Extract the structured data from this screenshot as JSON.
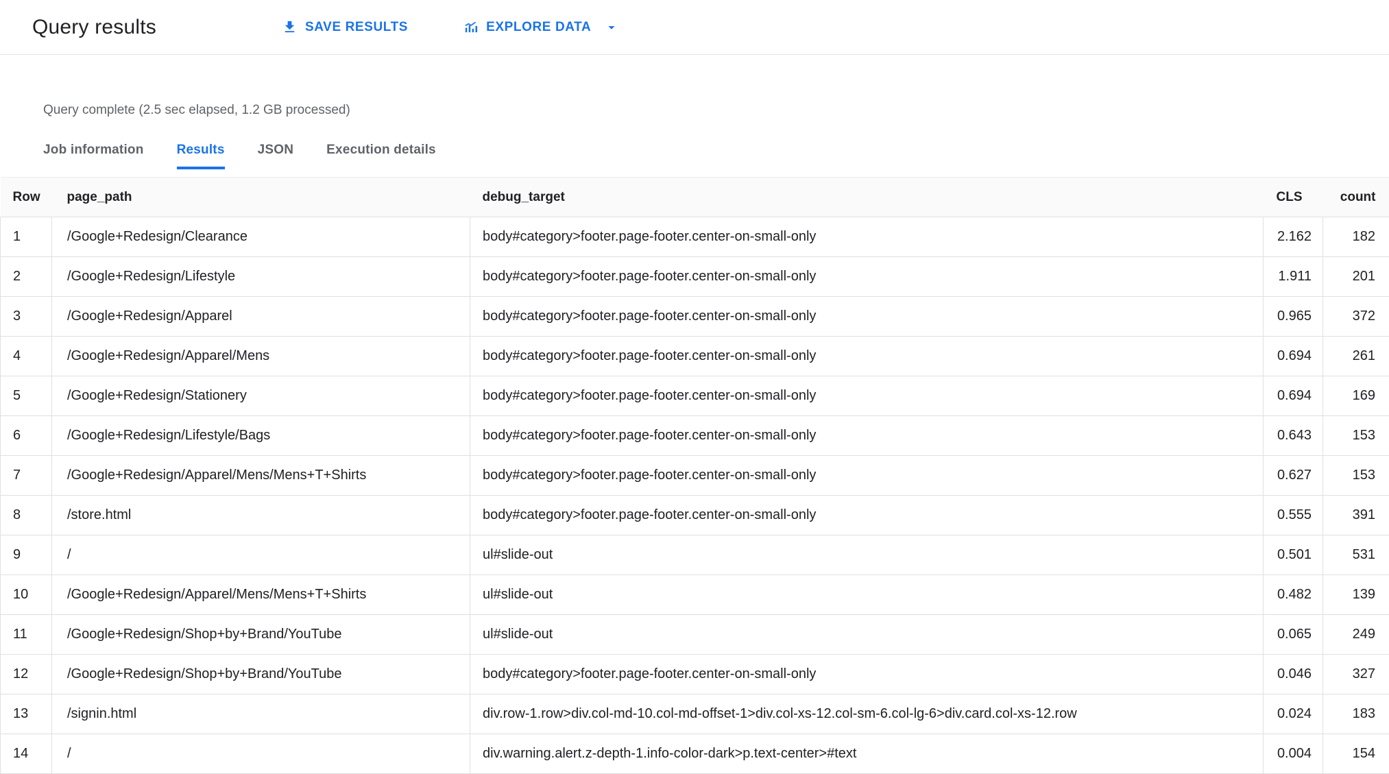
{
  "header": {
    "title": "Query results",
    "save_button": "SAVE RESULTS",
    "explore_button": "EXPLORE DATA"
  },
  "status": "Query complete (2.5 sec elapsed, 1.2 GB processed)",
  "tabs": [
    {
      "label": "Job information",
      "active": false
    },
    {
      "label": "Results",
      "active": true
    },
    {
      "label": "JSON",
      "active": false
    },
    {
      "label": "Execution details",
      "active": false
    }
  ],
  "colors": {
    "accent": "#1a73e8",
    "text": "#202124",
    "secondary_text": "#5f6368",
    "border": "#e0e0e0",
    "header_row_bg": "#fafafa"
  },
  "table": {
    "columns": [
      "Row",
      "page_path",
      "debug_target",
      "CLS",
      "count"
    ],
    "rows": [
      {
        "row": "1",
        "page_path": "/Google+Redesign/Clearance",
        "debug_target": "body#category>footer.page-footer.center-on-small-only",
        "cls": "2.162",
        "count": "182"
      },
      {
        "row": "2",
        "page_path": "/Google+Redesign/Lifestyle",
        "debug_target": "body#category>footer.page-footer.center-on-small-only",
        "cls": "1.911",
        "count": "201"
      },
      {
        "row": "3",
        "page_path": "/Google+Redesign/Apparel",
        "debug_target": "body#category>footer.page-footer.center-on-small-only",
        "cls": "0.965",
        "count": "372"
      },
      {
        "row": "4",
        "page_path": "/Google+Redesign/Apparel/Mens",
        "debug_target": "body#category>footer.page-footer.center-on-small-only",
        "cls": "0.694",
        "count": "261"
      },
      {
        "row": "5",
        "page_path": "/Google+Redesign/Stationery",
        "debug_target": "body#category>footer.page-footer.center-on-small-only",
        "cls": "0.694",
        "count": "169"
      },
      {
        "row": "6",
        "page_path": "/Google+Redesign/Lifestyle/Bags",
        "debug_target": "body#category>footer.page-footer.center-on-small-only",
        "cls": "0.643",
        "count": "153"
      },
      {
        "row": "7",
        "page_path": "/Google+Redesign/Apparel/Mens/Mens+T+Shirts",
        "debug_target": "body#category>footer.page-footer.center-on-small-only",
        "cls": "0.627",
        "count": "153"
      },
      {
        "row": "8",
        "page_path": "/store.html",
        "debug_target": "body#category>footer.page-footer.center-on-small-only",
        "cls": "0.555",
        "count": "391"
      },
      {
        "row": "9",
        "page_path": "/",
        "debug_target": "ul#slide-out",
        "cls": "0.501",
        "count": "531"
      },
      {
        "row": "10",
        "page_path": "/Google+Redesign/Apparel/Mens/Mens+T+Shirts",
        "debug_target": "ul#slide-out",
        "cls": "0.482",
        "count": "139"
      },
      {
        "row": "11",
        "page_path": "/Google+Redesign/Shop+by+Brand/YouTube",
        "debug_target": "ul#slide-out",
        "cls": "0.065",
        "count": "249"
      },
      {
        "row": "12",
        "page_path": "/Google+Redesign/Shop+by+Brand/YouTube",
        "debug_target": "body#category>footer.page-footer.center-on-small-only",
        "cls": "0.046",
        "count": "327"
      },
      {
        "row": "13",
        "page_path": "/signin.html",
        "debug_target": "div.row-1.row>div.col-md-10.col-md-offset-1>div.col-xs-12.col-sm-6.col-lg-6>div.card.col-xs-12.row",
        "cls": "0.024",
        "count": "183"
      },
      {
        "row": "14",
        "page_path": "/",
        "debug_target": "div.warning.alert.z-depth-1.info-color-dark>p.text-center>#text",
        "cls": "0.004",
        "count": "154"
      }
    ]
  }
}
